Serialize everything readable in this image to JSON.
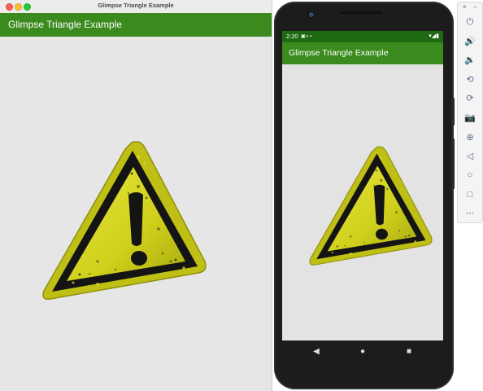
{
  "desktop_window": {
    "title": "Glimpse Triangle Example",
    "app_bar_title": "Glimpse Triangle Example"
  },
  "phone": {
    "status_time": "2:20",
    "app_bar_title": "Glimpse Triangle Example"
  },
  "emulator_toolbar": {
    "top_icons": [
      "close-icon",
      "minimize-icon"
    ],
    "buttons": [
      "power-icon",
      "volume-up-icon",
      "volume-down-icon",
      "rotate-left-icon",
      "rotate-right-icon",
      "camera-icon",
      "zoom-icon",
      "back-icon",
      "home-icon",
      "overview-icon",
      "more-icon"
    ]
  },
  "colors": {
    "app_bar": "#3a8a1e",
    "status_bar": "#1e6a12",
    "sign_yellow": "#d2d318",
    "sign_black": "#141414"
  }
}
